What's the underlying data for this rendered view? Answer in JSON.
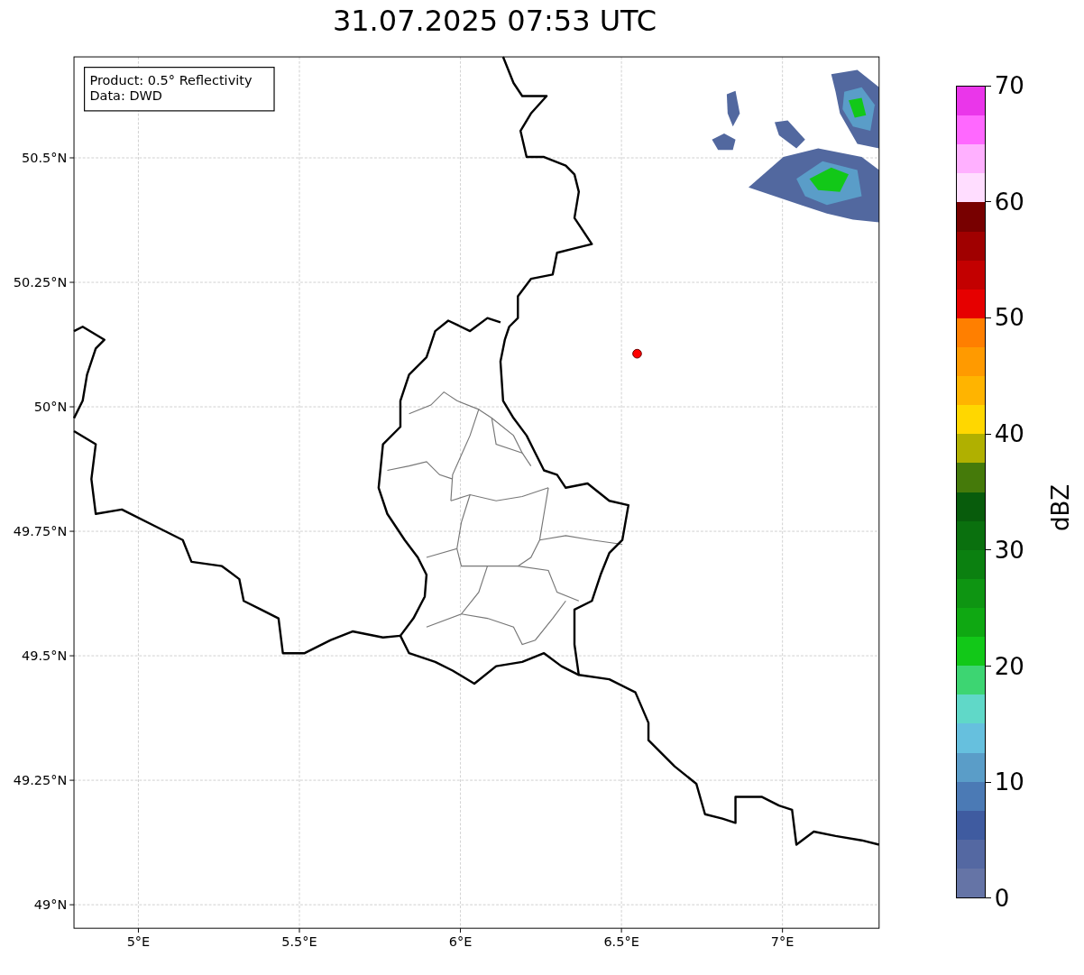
{
  "title": "31.07.2025 07:53 UTC",
  "info_box": [
    "Product: 0.5° Reflectivity",
    "Data: DWD"
  ],
  "map": {
    "x_ticks": [
      "5°E",
      "5.5°E",
      "6°E",
      "6.5°E",
      "7°E"
    ],
    "y_ticks": [
      "50.5°N",
      "50.25°N",
      "50°N",
      "49.75°N",
      "49.5°N",
      "49.25°N",
      "49°N"
    ]
  },
  "colorbar": {
    "label": "dBZ",
    "ticks": [
      "70",
      "60",
      "50",
      "40",
      "30",
      "20",
      "10",
      "0"
    ],
    "bins": [
      {
        "color": "#ea36ea"
      },
      {
        "color": "#ff68ff"
      },
      {
        "color": "#ffb0ff"
      },
      {
        "color": "#ffddff"
      },
      {
        "color": "#780000"
      },
      {
        "color": "#a00000"
      },
      {
        "color": "#c30000"
      },
      {
        "color": "#e60000"
      },
      {
        "color": "#ff7f00"
      },
      {
        "color": "#ff9a00"
      },
      {
        "color": "#ffb400"
      },
      {
        "color": "#ffd700"
      },
      {
        "color": "#b0b000"
      },
      {
        "color": "#457a0a"
      },
      {
        "color": "#085c0c"
      },
      {
        "color": "#0a700e"
      },
      {
        "color": "#0b8010"
      },
      {
        "color": "#0e9512"
      },
      {
        "color": "#0fa812"
      },
      {
        "color": "#12c818"
      },
      {
        "color": "#3dd572"
      },
      {
        "color": "#60d8c8"
      },
      {
        "color": "#66c0de"
      },
      {
        "color": "#5a9dc8"
      },
      {
        "color": "#4b7ab5"
      },
      {
        "color": "#3f5ba0"
      },
      {
        "color": "#5468a2"
      },
      {
        "color": "#6574a6"
      }
    ]
  }
}
